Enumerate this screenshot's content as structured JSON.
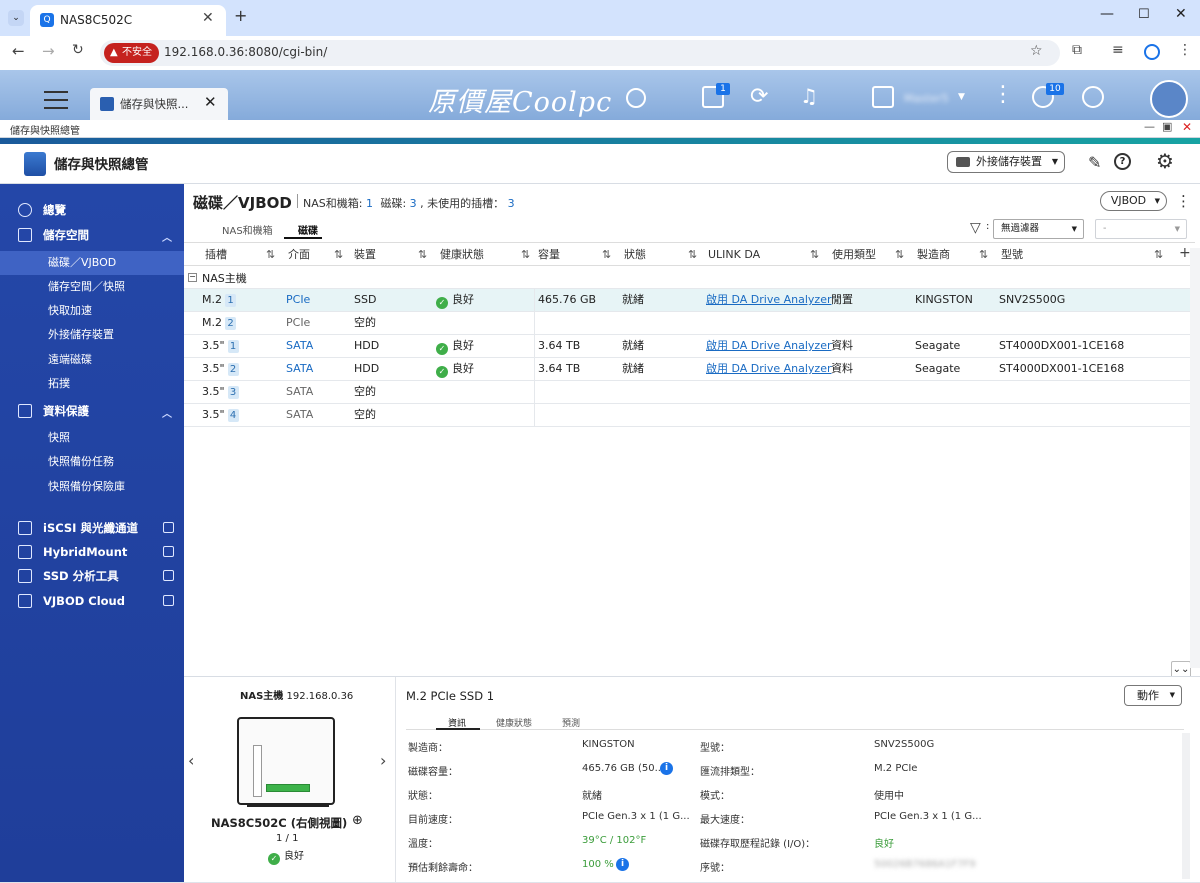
{
  "browser": {
    "tab_title": "NAS8C502C",
    "url": "192.168.0.36:8080/cgi-bin/",
    "insecure_label": "不安全"
  },
  "qnap": {
    "app_tab_title": "儲存與快照...",
    "logo_text": "原價屋Coolpc",
    "user_name": "Master5",
    "notification_count_1": "1",
    "notification_count_2": "10"
  },
  "window": {
    "title": "儲存與快照總管"
  },
  "app": {
    "title": "儲存與快照總管",
    "external_button": "外接儲存裝置"
  },
  "sidebar": {
    "items": [
      {
        "label": "總覽",
        "type": "top",
        "icon": "dashboard-icon"
      },
      {
        "label": "儲存空間",
        "type": "top",
        "icon": "database-icon",
        "chev": "^"
      },
      {
        "label": "磁碟／VJBOD",
        "type": "sub",
        "selected": true
      },
      {
        "label": "儲存空間／快照",
        "type": "sub"
      },
      {
        "label": "快取加速",
        "type": "sub"
      },
      {
        "label": "外接儲存裝置",
        "type": "sub"
      },
      {
        "label": "遠端磁碟",
        "type": "sub"
      },
      {
        "label": "拓撲",
        "type": "sub"
      },
      {
        "label": "資料保護",
        "type": "top",
        "icon": "shield-icon",
        "chev": "^"
      },
      {
        "label": "快照",
        "type": "sub"
      },
      {
        "label": "快照備份任務",
        "type": "sub"
      },
      {
        "label": "快照備份保險庫",
        "type": "sub"
      },
      {
        "label": "iSCSI 與光纖通道",
        "type": "top",
        "icon": "iscsi-icon",
        "ext": true
      },
      {
        "label": "HybridMount",
        "type": "top",
        "icon": "cloud-mount-icon",
        "ext": true
      },
      {
        "label": "SSD 分析工具",
        "type": "top",
        "icon": "ssd-icon",
        "ext": true
      },
      {
        "label": "VJBOD Cloud",
        "type": "top",
        "icon": "vjbod-cloud-icon",
        "ext": true
      }
    ]
  },
  "page": {
    "title": "磁碟／VJBOD",
    "summary_label1": "NAS和機箱:",
    "summary_value1": "1",
    "summary_label2": "磁碟:",
    "summary_value2": "3",
    "summary_label3": ", 未使用的插槽：",
    "summary_value3": "3",
    "vjbod_button": "VJBOD",
    "tabs": [
      "NAS和機箱",
      "磁碟"
    ],
    "filter_label": "無過濾器",
    "filter2": "-"
  },
  "table": {
    "headers": [
      "插槽",
      "介面",
      "裝置",
      "健康狀態",
      "容量",
      "狀態",
      "ULINK DA",
      "使用類型",
      "製造商",
      "型號"
    ],
    "group": "NAS主機",
    "rows": [
      {
        "slot": "M.2",
        "num": "1",
        "iface": "PCIe",
        "device": "SSD",
        "health": "良好",
        "capacity": "465.76 GB",
        "status": "就緒",
        "ulink": "啟用 DA Drive Analyzer",
        "usage": "閒置",
        "vendor": "KINGSTON",
        "model": "SNV2S500G",
        "selected": true
      },
      {
        "slot": "M.2",
        "num": "2",
        "iface": "PCIe",
        "device": "空的",
        "health": "",
        "capacity": "",
        "status": "",
        "ulink": "",
        "usage": "",
        "vendor": "",
        "model": ""
      },
      {
        "slot": "3.5\"",
        "num": "1",
        "iface": "SATA",
        "device": "HDD",
        "health": "良好",
        "capacity": "3.64 TB",
        "status": "就緒",
        "ulink": "啟用 DA Drive Analyzer",
        "usage": "資料",
        "vendor": "Seagate",
        "model": "ST4000DX001-1CE168"
      },
      {
        "slot": "3.5\"",
        "num": "2",
        "iface": "SATA",
        "device": "HDD",
        "health": "良好",
        "capacity": "3.64 TB",
        "status": "就緒",
        "ulink": "啟用 DA Drive Analyzer",
        "usage": "資料",
        "vendor": "Seagate",
        "model": "ST4000DX001-1CE168"
      },
      {
        "slot": "3.5\"",
        "num": "3",
        "iface": "SATA",
        "device": "空的",
        "health": "",
        "capacity": "",
        "status": "",
        "ulink": "",
        "usage": "",
        "vendor": "",
        "model": ""
      },
      {
        "slot": "3.5\"",
        "num": "4",
        "iface": "SATA",
        "device": "空的",
        "health": "",
        "capacity": "",
        "status": "",
        "ulink": "",
        "usage": "",
        "vendor": "",
        "model": ""
      }
    ]
  },
  "detail": {
    "nas_label": "NAS主機",
    "nas_ip": "192.168.0.36",
    "device_name": "NAS8C502C (右側視圖)",
    "page": "1 / 1",
    "health": "良好",
    "title": "M.2 PCIe SSD 1",
    "action_button": "動作",
    "tabs": [
      "資訊",
      "健康狀態",
      "預測"
    ],
    "left": [
      {
        "k": "製造商：",
        "v": "KINGSTON"
      },
      {
        "k": "磁碟容量：",
        "v": "465.76 GB (50...",
        "info": true
      },
      {
        "k": "狀態：",
        "v": "就緒"
      },
      {
        "k": "目前速度：",
        "v": "PCIe Gen.3 x 1 (1 G..."
      },
      {
        "k": "溫度：",
        "v": "39°C / 102°F",
        "green": true
      },
      {
        "k": "預估剩餘壽命：",
        "v": "100 %",
        "green": true,
        "info": true
      }
    ],
    "right": [
      {
        "k": "型號：",
        "v": "SNV2S500G"
      },
      {
        "k": "匯流排類型：",
        "v": "M.2 PCIe"
      },
      {
        "k": "模式：",
        "v": "使用中"
      },
      {
        "k": "最大速度：",
        "v": "PCIe Gen.3 x 1 (1 G..."
      },
      {
        "k": "磁碟存取歷程記錄 (I/O)：",
        "v": "良好",
        "green": true
      },
      {
        "k": "序號：",
        "v": "50026B7686A1F7F9",
        "blur": true
      }
    ]
  }
}
